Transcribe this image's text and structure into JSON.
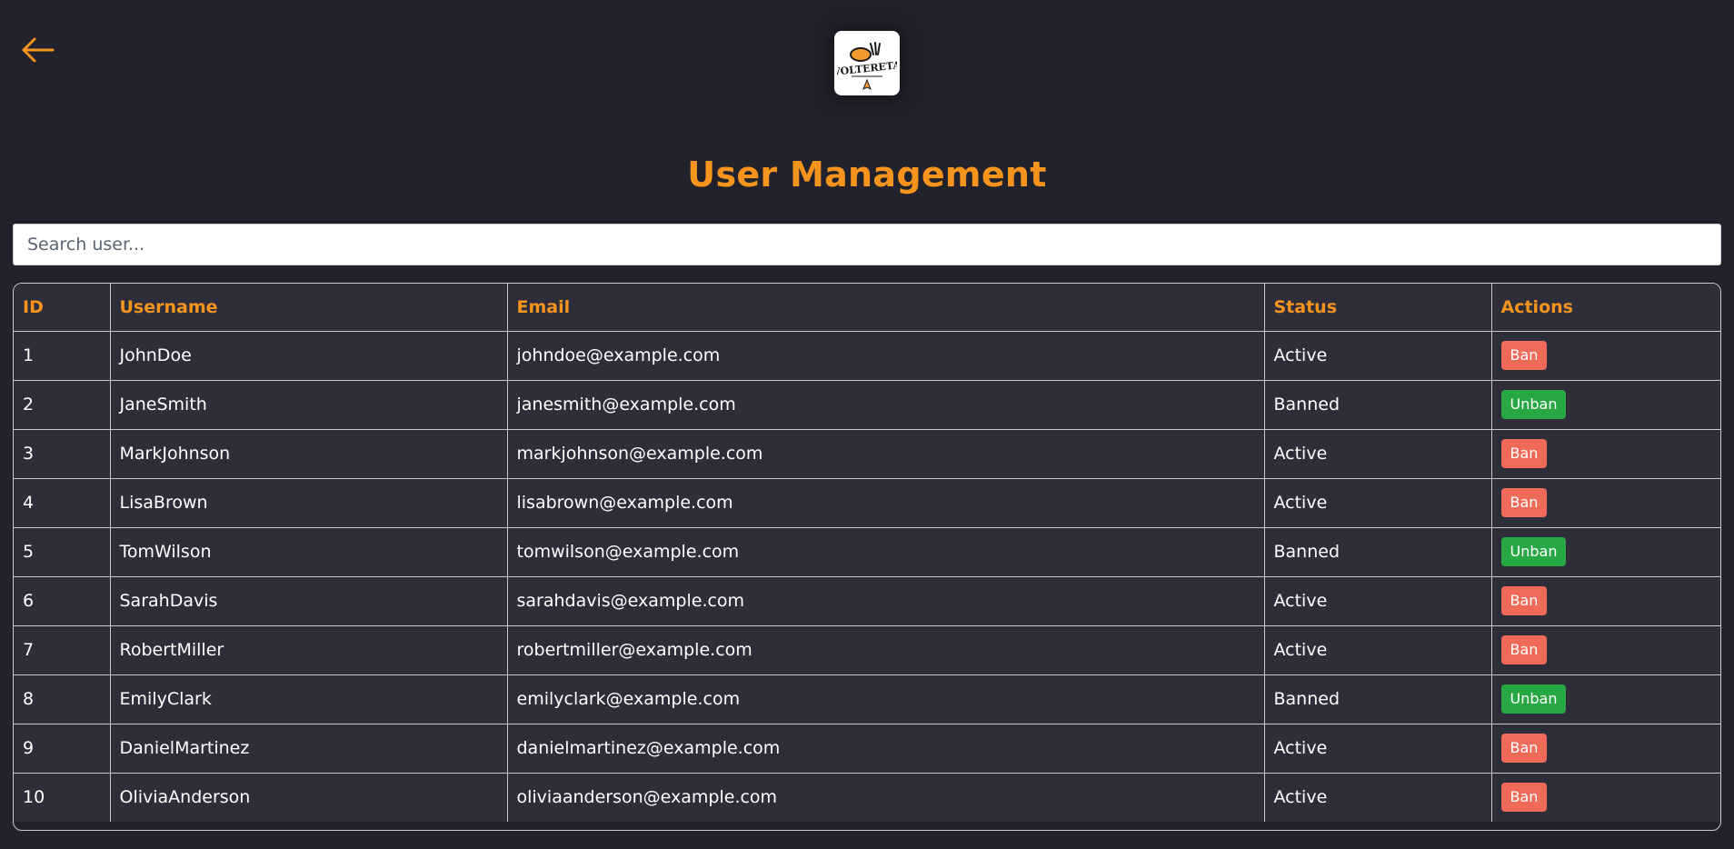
{
  "nav": {
    "back_icon": "arrow-left-icon",
    "accent_color": "#f7941d"
  },
  "logo": {
    "text": "VOLTERETA"
  },
  "page_title": "User Management",
  "search": {
    "placeholder": "Search user...",
    "value": ""
  },
  "table": {
    "headers": [
      "ID",
      "Username",
      "Email",
      "Status",
      "Actions"
    ],
    "rows": [
      {
        "id": "1",
        "username": "JohnDoe",
        "email": "johndoe@example.com",
        "status": "Active",
        "action": "Ban"
      },
      {
        "id": "2",
        "username": "JaneSmith",
        "email": "janesmith@example.com",
        "status": "Banned",
        "action": "Unban"
      },
      {
        "id": "3",
        "username": "MarkJohnson",
        "email": "markjohnson@example.com",
        "status": "Active",
        "action": "Ban"
      },
      {
        "id": "4",
        "username": "LisaBrown",
        "email": "lisabrown@example.com",
        "status": "Active",
        "action": "Ban"
      },
      {
        "id": "5",
        "username": "TomWilson",
        "email": "tomwilson@example.com",
        "status": "Banned",
        "action": "Unban"
      },
      {
        "id": "6",
        "username": "SarahDavis",
        "email": "sarahdavis@example.com",
        "status": "Active",
        "action": "Ban"
      },
      {
        "id": "7",
        "username": "RobertMiller",
        "email": "robertmiller@example.com",
        "status": "Active",
        "action": "Ban"
      },
      {
        "id": "8",
        "username": "EmilyClark",
        "email": "emilyclark@example.com",
        "status": "Banned",
        "action": "Unban"
      },
      {
        "id": "9",
        "username": "DanielMartinez",
        "email": "danielmartinez@example.com",
        "status": "Active",
        "action": "Ban"
      },
      {
        "id": "10",
        "username": "OliviaAnderson",
        "email": "oliviaanderson@example.com",
        "status": "Active",
        "action": "Ban"
      }
    ]
  },
  "colors": {
    "background": "#22222d",
    "table_bg": "#2d2e3a",
    "ban_button": "#f06a5a",
    "unban_button": "#28a745"
  }
}
